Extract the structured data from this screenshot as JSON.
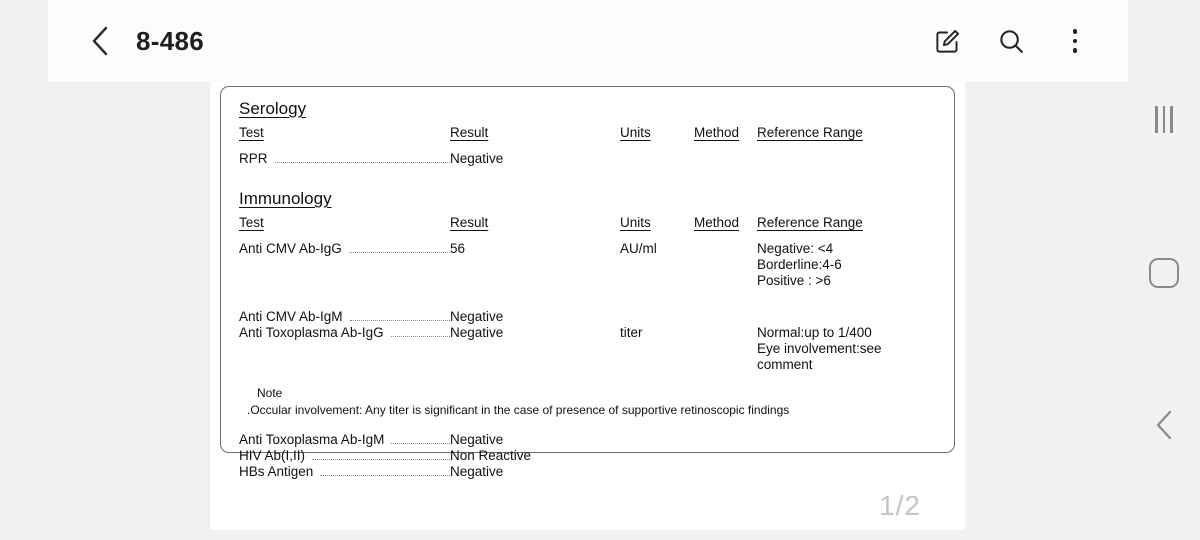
{
  "appbar": {
    "back_icon": "chevron-left-icon",
    "title": "8-486",
    "edit_icon": "edit-square-icon",
    "search_icon": "search-icon",
    "overflow_icon": "more-vertical-icon"
  },
  "document": {
    "page_indicator": "1/2",
    "columns": {
      "test": "Test",
      "result": "Result",
      "units": "Units",
      "method": "Method",
      "reference": "Reference Range"
    },
    "sections": [
      {
        "title": "Serology",
        "rows": [
          {
            "test": "RPR",
            "result": "Negative",
            "units": "",
            "method": "",
            "reference": ""
          }
        ]
      },
      {
        "title": "Immunology",
        "rows": [
          {
            "test": "Anti CMV Ab-IgG",
            "result": "56",
            "units": "AU/ml",
            "method": "",
            "reference": "Negative: <4\nBorderline:4-6\nPositive : >6"
          },
          {
            "test": "Anti CMV Ab-IgM",
            "result": "Negative",
            "units": "",
            "method": "",
            "reference": ""
          },
          {
            "test": "Anti Toxoplasma Ab-IgG",
            "result": "Negative",
            "units": "titer",
            "method": "",
            "reference": "Normal:up to 1/400\nEye involvement:see comment"
          },
          {
            "test": "Anti Toxoplasma Ab-IgM",
            "result": "Negative",
            "units": "",
            "method": "",
            "reference": ""
          },
          {
            "test": "HIV Ab(I,II)",
            "result": "Non Reactive",
            "units": "",
            "method": "",
            "reference": ""
          },
          {
            "test": "HBs Antigen",
            "result": "Negative",
            "units": "",
            "method": "",
            "reference": ""
          }
        ]
      }
    ],
    "note": {
      "label": "Note",
      "text": ".Occular involvement: Any titer is significant in the case of presence of supportive retinoscopic findings"
    }
  },
  "navbar": {
    "recents_icon": "recents-icon",
    "home_icon": "home-square-icon",
    "back_icon": "chevron-left-icon"
  },
  "colors": {
    "background": "#f1f1f1",
    "appbar": "#fcfcfc",
    "page": "#ffffff",
    "card_border": "#6d6d6d",
    "text": "#111111",
    "page_number": "#c4c4c4",
    "nav_icon": "#8a8a8a"
  }
}
